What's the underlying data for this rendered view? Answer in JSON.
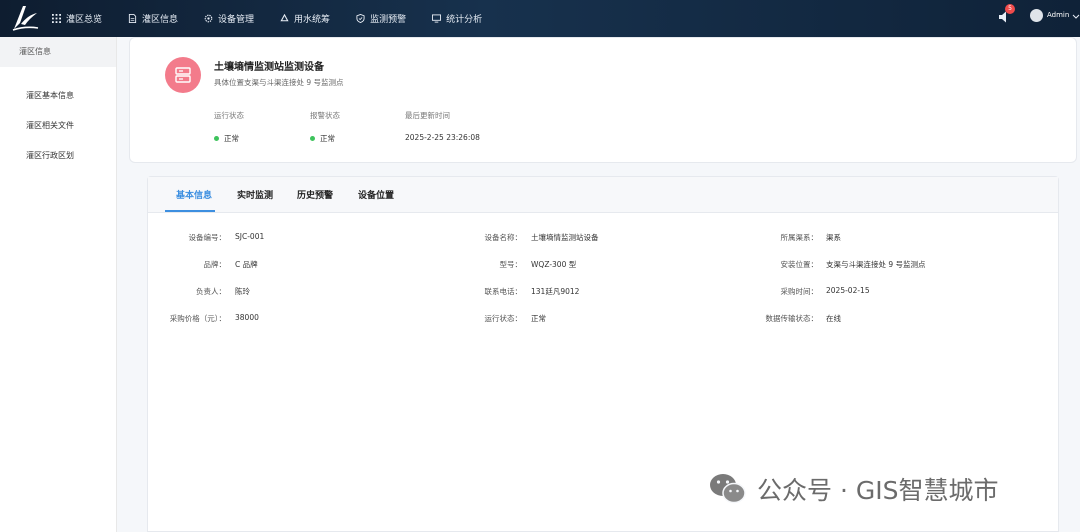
{
  "nav": {
    "items": [
      {
        "label": "灌区总览",
        "icon": "grid-icon"
      },
      {
        "label": "灌区信息",
        "icon": "document-icon"
      },
      {
        "label": "设备管理",
        "icon": "gear-icon"
      },
      {
        "label": "用水统筹",
        "icon": "recycle-icon"
      },
      {
        "label": "监测预警",
        "icon": "shield-icon"
      },
      {
        "label": "统计分析",
        "icon": "monitor-icon"
      }
    ],
    "notification_count": "5",
    "user": "Admin"
  },
  "sidebar": {
    "title": "灌区信息",
    "items": [
      {
        "label": "灌区基本信息"
      },
      {
        "label": "灌区相关文件"
      },
      {
        "label": "灌区行政区划"
      }
    ]
  },
  "device": {
    "name": "土壤墒情监测站监测设备",
    "location": "具体位置支渠与斗渠连接处 9 号监测点",
    "run_status_label": "运行状态",
    "run_status_value": "正常",
    "alarm_status_label": "报警状态",
    "alarm_status_value": "正常",
    "updated_label": "最后更新时间",
    "updated_value": "2025-2-25 23:26:08"
  },
  "tabs": [
    {
      "label": "基本信息",
      "active": true
    },
    {
      "label": "实时监测",
      "active": false
    },
    {
      "label": "历史预警",
      "active": false
    },
    {
      "label": "设备位置",
      "active": false
    }
  ],
  "fields": [
    [
      {
        "label": "设备编号：",
        "value": "SJC-001"
      },
      {
        "label": "设备名称：",
        "value": "土壤墒情监测站设备"
      },
      {
        "label": "所属渠系：",
        "value": "渠系"
      }
    ],
    [
      {
        "label": "品牌：",
        "value": "C 品牌"
      },
      {
        "label": "型号：",
        "value": "WQZ-300 型"
      },
      {
        "label": "安装位置：",
        "value": "支渠与斗渠连接处 9 号监测点"
      }
    ],
    [
      {
        "label": "负责人：",
        "value": "陈玲"
      },
      {
        "label": "联系电话：",
        "value": "131廷凡9012"
      },
      {
        "label": "采购时间：",
        "value": "2025-02-15"
      }
    ],
    [
      {
        "label": "采购价格（元）：",
        "value": "38000"
      },
      {
        "label": "运行状态：",
        "value": "正常"
      },
      {
        "label": "数据传输状态：",
        "value": "在线"
      }
    ]
  ],
  "watermark": "公众号 · GIS智慧城市",
  "colors": {
    "accent": "#3d8fe0",
    "status_ok": "#3ec35c",
    "device_icon_bg": "#f37b8b",
    "badge": "#f04b4b",
    "topbar": "#17314d"
  }
}
